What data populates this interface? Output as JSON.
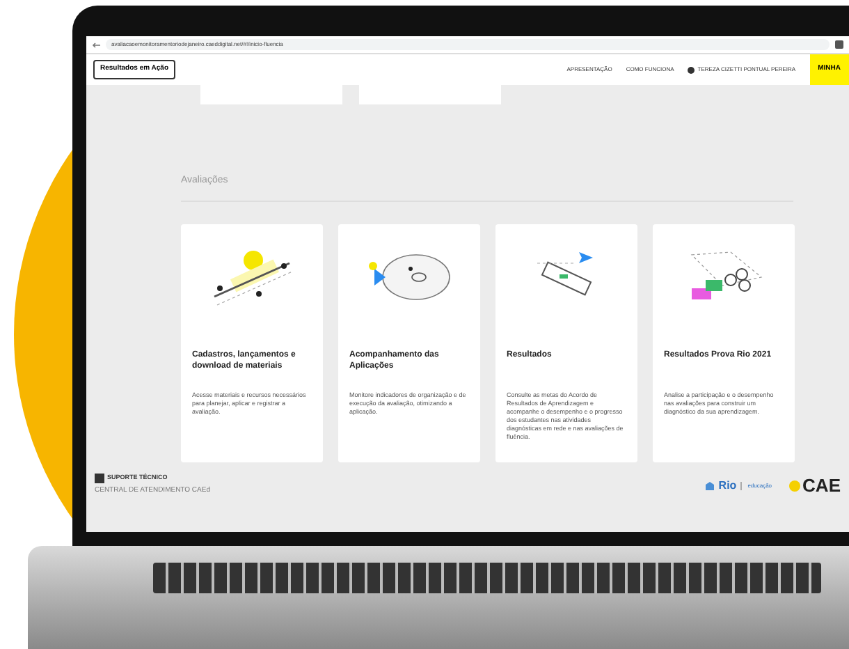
{
  "browser": {
    "url": "avaliacaoemonitoramentoriodejaneiro.caeddigital.net/#!/inicio-fluencia"
  },
  "header": {
    "brand_button": "Resultados em Ação",
    "nav": [
      "APRESENTAÇÃO",
      "COMO FUNCIONA"
    ],
    "user": "TEREZA CIZETTI PONTUAL PEREIRA",
    "action_button": "MINHA"
  },
  "section": {
    "title": "Avaliações"
  },
  "cards": [
    {
      "kind": "materials",
      "title": "Cadastros, lançamentos e download de materiais",
      "text": "Acesse materiais e recursos necessários para planejar, aplicar e registrar a avaliação."
    },
    {
      "kind": "monitoring",
      "title": "Acompanhamento das Aplicações",
      "text": "Monitore indicadores de organização e de execução da avaliação, otimizando a aplicação."
    },
    {
      "kind": "results",
      "title": "Resultados",
      "text": "Consulte as metas do Acordo de Resultados de Aprendizagem e acompanhe o desempenho e o progresso dos estudantes nas atividades diagnósticas em rede e nas avaliações de fluência."
    },
    {
      "kind": "prova",
      "title": "Resultados Prova Rio 2021",
      "text": "Analise a participação e o desempenho nas avaliações para construir um diagnóstico da sua aprendizagem."
    }
  ],
  "footer": {
    "support": "SUPORTE TÉCNICO",
    "support_text": "CENTRAL DE ATENDIMENTO CAEd",
    "rio": "Rio",
    "rio_sub": "educação",
    "cae": "CAE"
  }
}
